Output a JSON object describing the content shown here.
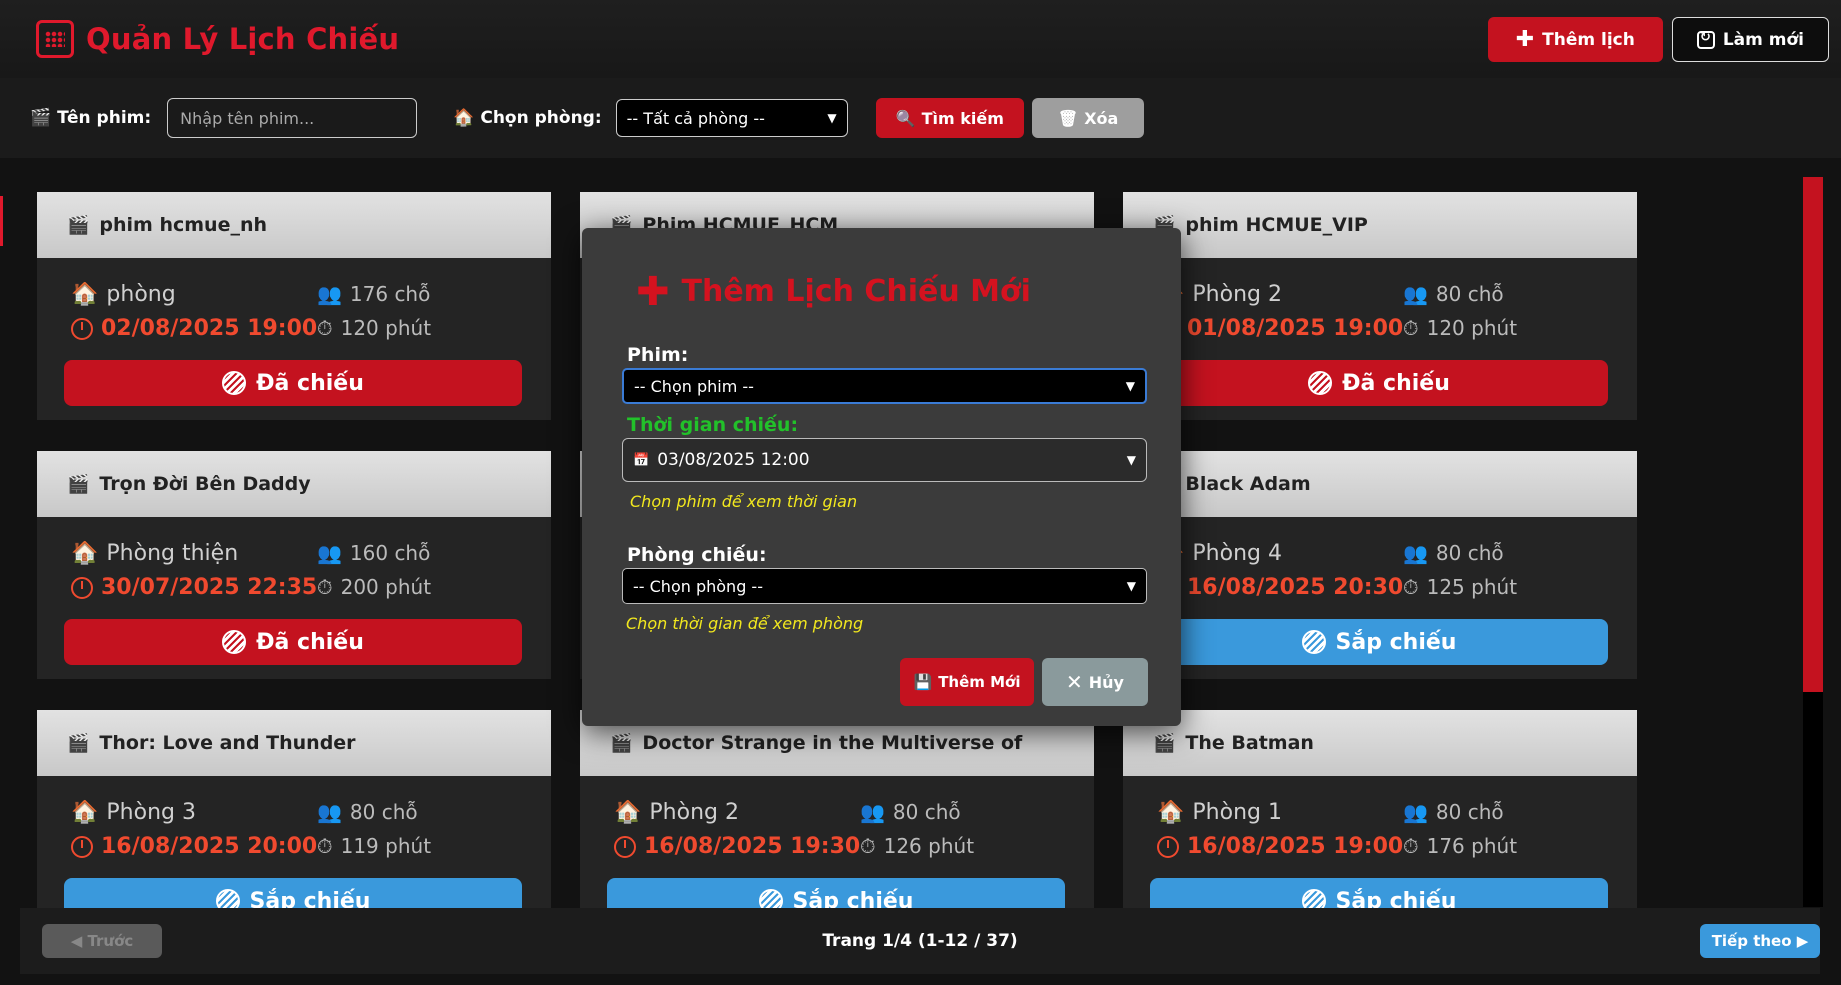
{
  "header": {
    "title": "Quản Lý Lịch Chiếu",
    "add_label": "Thêm lịch",
    "refresh_label": "Làm mới"
  },
  "filters": {
    "name_label": "Tên phim:",
    "name_placeholder": "Nhập tên phim...",
    "room_label": "Chọn phòng:",
    "room_value": "-- Tất cả phòng --",
    "search_label": "Tìm kiếm",
    "clear_label": "Xóa"
  },
  "cards": [
    {
      "title": "phim hcmue_nh",
      "room": "phòng",
      "seats": "176 chỗ",
      "time": "02/08/2025 19:00",
      "duration": "120 phút",
      "status": "Đã chiếu",
      "kind": "done"
    },
    {
      "title": "Phim HCMUE_HCM",
      "room": "",
      "seats": "",
      "time": "",
      "duration": "",
      "status": "",
      "kind": "hidden"
    },
    {
      "title": "phim HCMUE_VIP",
      "room": "Phòng 2",
      "seats": "80 chỗ",
      "time": "01/08/2025 19:00",
      "duration": "120 phút",
      "status": "Đã chiếu",
      "kind": "done"
    },
    {
      "title": "Trọn Đời Bên Daddy",
      "room": "Phòng thiện",
      "seats": "160 chỗ",
      "time": "30/07/2025 22:35",
      "duration": "200 phút",
      "status": "Đã chiếu",
      "kind": "done"
    },
    {
      "title": "",
      "room": "",
      "seats": "",
      "time": "",
      "duration": "",
      "status": "",
      "kind": "hidden"
    },
    {
      "title": "Black Adam",
      "room": "Phòng 4",
      "seats": "80 chỗ",
      "time": "16/08/2025 20:30",
      "duration": "125 phút",
      "status": "Sắp chiếu",
      "kind": "soon"
    },
    {
      "title": "Thor: Love and Thunder",
      "room": "Phòng 3",
      "seats": "80 chỗ",
      "time": "16/08/2025 20:00",
      "duration": "119 phút",
      "status": "Sắp chiếu",
      "kind": "soon"
    },
    {
      "title": "Doctor Strange in the Multiverse of",
      "room": "Phòng 2",
      "seats": "80 chỗ",
      "time": "16/08/2025 19:30",
      "duration": "126 phút",
      "status": "Sắp chiếu",
      "kind": "soon"
    },
    {
      "title": "The Batman",
      "room": "Phòng 1",
      "seats": "80 chỗ",
      "time": "16/08/2025 19:00",
      "duration": "176 phút",
      "status": "Sắp chiếu",
      "kind": "soon"
    }
  ],
  "pager": {
    "prev_label": "◀ Trước",
    "info": "Trang 1/4 (1-12 / 37)",
    "next_label": "Tiếp theo ▶"
  },
  "modal": {
    "title": "Thêm Lịch Chiếu Mới",
    "movie_label": "Phim:",
    "movie_value": "-- Chọn phim --",
    "time_label": "Thời gian chiếu:",
    "time_value": "03/08/2025 12:00",
    "time_hint": "Chọn phim để xem thời gian",
    "room_label": "Phòng chiếu:",
    "room_value": "-- Chọn phòng --",
    "room_hint": "Chọn thời gian để xem phòng",
    "save_label": "Thêm Mới",
    "cancel_label": "Hủy"
  },
  "colors": {
    "accent": "#c4121f",
    "upcoming": "#3a99dc",
    "hint": "#f2e81e",
    "time_label": "#22c12a"
  }
}
